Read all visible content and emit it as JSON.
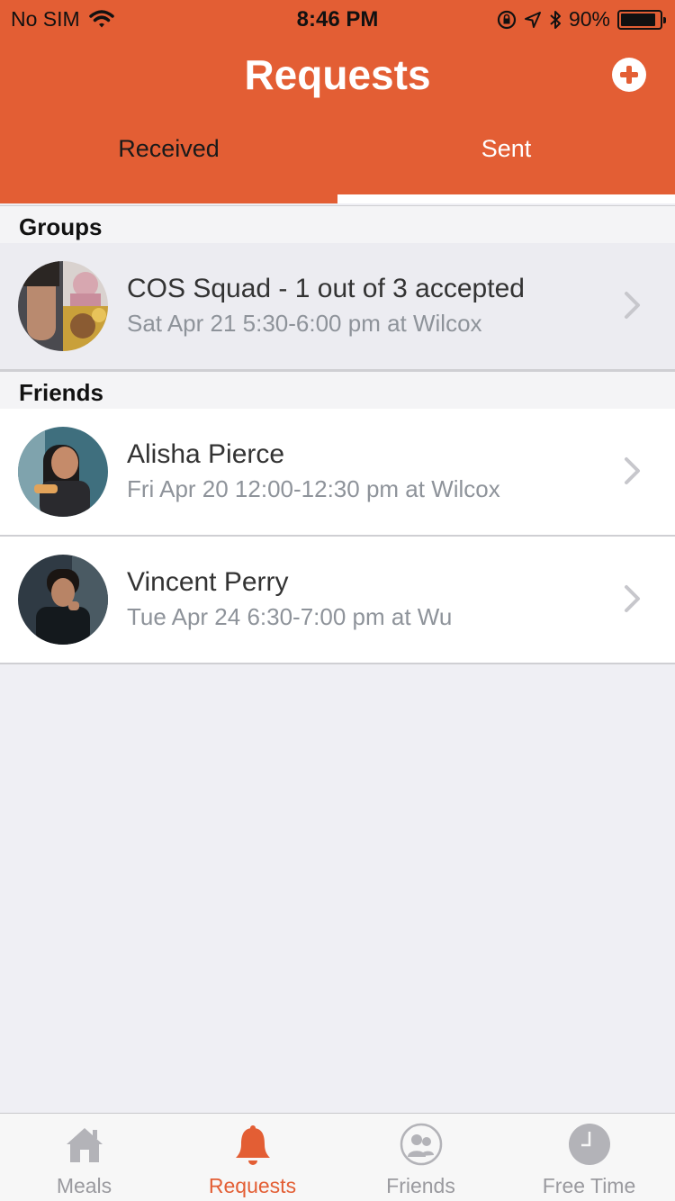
{
  "status_bar": {
    "carrier": "No SIM",
    "time": "8:46 PM",
    "battery_percent": "90%",
    "battery_level": 0.9
  },
  "header": {
    "title": "Requests",
    "add_icon": "plus-circle-icon"
  },
  "tabs": [
    {
      "label": "Received",
      "active": false
    },
    {
      "label": "Sent",
      "active": true
    }
  ],
  "sections": {
    "groups": {
      "header": "Groups",
      "items": [
        {
          "title": "COS Squad - 1 out of 3 accepted",
          "subtitle": "Sat Apr 21 5:30-6:00 pm at Wilcox"
        }
      ]
    },
    "friends": {
      "header": "Friends",
      "items": [
        {
          "title": "Alisha Pierce",
          "subtitle": "Fri Apr 20 12:00-12:30 pm at Wilcox"
        },
        {
          "title": "Vincent Perry",
          "subtitle": "Tue Apr 24 6:30-7:00 pm at Wu"
        }
      ]
    }
  },
  "tab_bar": [
    {
      "label": "Meals",
      "icon": "house-icon",
      "active": false
    },
    {
      "label": "Requests",
      "icon": "bell-icon",
      "active": true
    },
    {
      "label": "Friends",
      "icon": "people-icon",
      "active": false
    },
    {
      "label": "Free Time",
      "icon": "clock-icon",
      "active": false
    }
  ],
  "colors": {
    "accent": "#e35e34",
    "background": "#efeff4",
    "inactive": "#9a9a9f"
  }
}
